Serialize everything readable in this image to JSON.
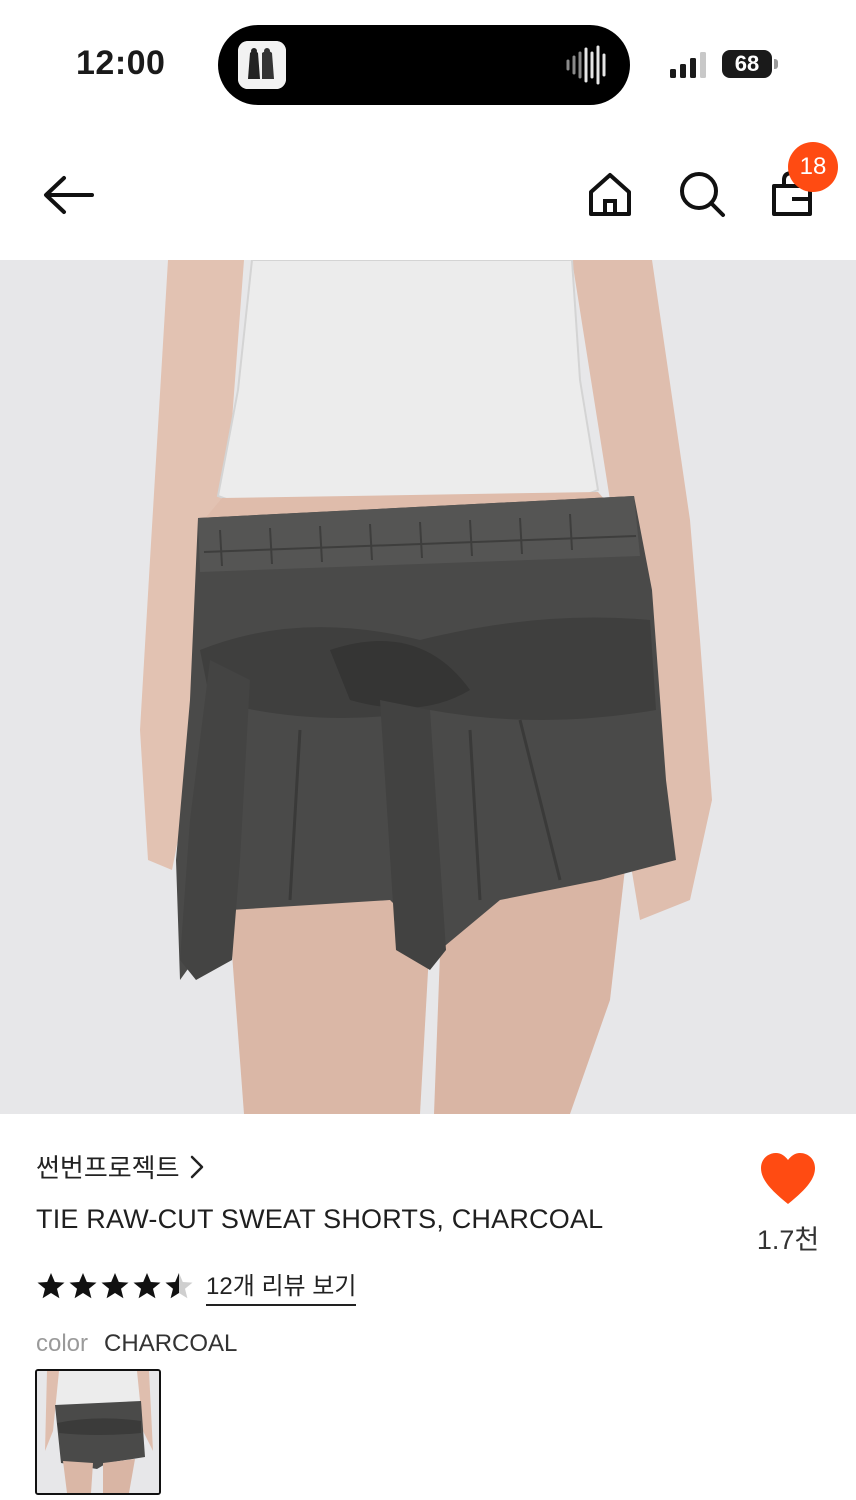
{
  "status_bar": {
    "time": "12:00",
    "battery": "68",
    "icons": [
      "now-playing-thumbnail",
      "waveform-icon",
      "signal-icon",
      "battery-icon"
    ]
  },
  "header": {
    "icons": [
      "back-arrow-icon",
      "home-icon",
      "search-icon",
      "shopping-bag-icon"
    ],
    "cart_count": "18"
  },
  "product": {
    "brand": "썬번프로젝트",
    "title": "TIE RAW-CUT SWEAT SHORTS, CHARCOAL",
    "like_count": "1.7천",
    "rating": 4.5,
    "review_link": "12개 리뷰 보기",
    "color_label": "color",
    "color_value": "CHARCOAL"
  },
  "colors": {
    "accent": "#ff4b12",
    "image_bg": "#e7e7e9"
  }
}
